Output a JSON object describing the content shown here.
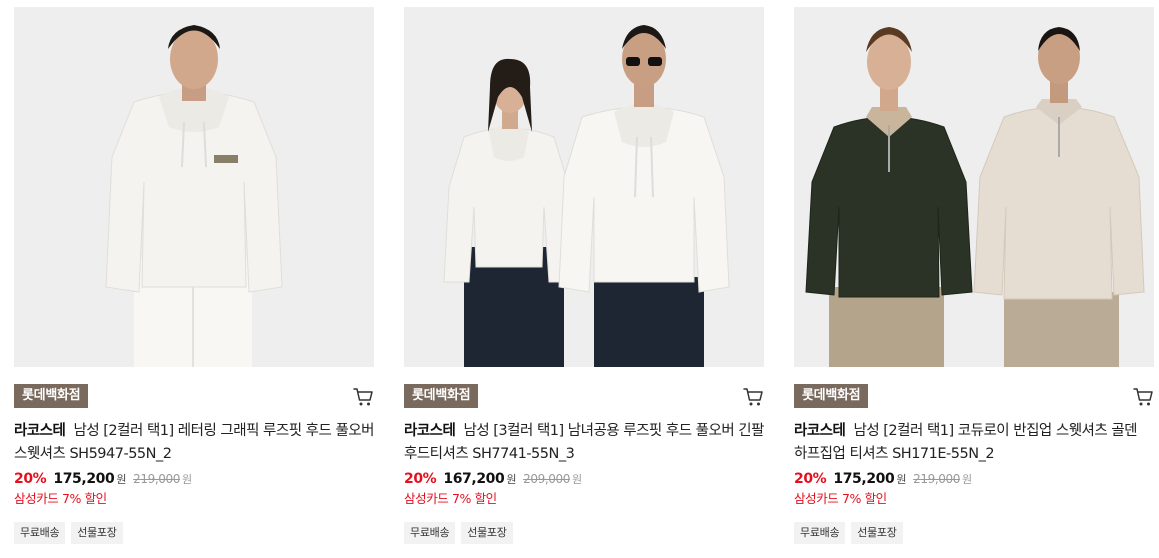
{
  "products": [
    {
      "store": "롯데백화점",
      "brand": "라코스테",
      "name": "남성 [2컬러 택1] 레터링 그래픽 루즈핏 후드 풀오버 스웻셔츠 SH5947-55N_2",
      "discount": "20%",
      "price": "175,200",
      "currency": "원",
      "original_price": "219,000",
      "card_promo": "삼성카드 7% 할인",
      "tags": [
        "무료배송",
        "선물포장"
      ],
      "image": {
        "description": "model in white hoodie and white pants",
        "top_color": "#f4f3ef",
        "bottom_color": "#f7f6f3",
        "bg_color": "#eeeeee"
      }
    },
    {
      "store": "롯데백화점",
      "brand": "라코스테",
      "name": "남성 [3컬러 택1] 남녀공용 루즈핏 후드 풀오버 긴팔 후드티셔츠 SH7741-55N_3",
      "discount": "20%",
      "price": "167,200",
      "currency": "원",
      "original_price": "209,000",
      "card_promo": "삼성카드 7% 할인",
      "tags": [
        "무료배송",
        "선물포장"
      ],
      "image": {
        "description": "two models in white hoodies and navy bottoms",
        "top_color": "#f4f3ef",
        "bottom_color": "#1e2533",
        "bg_color": "#eeeeee"
      }
    },
    {
      "store": "롯데백화점",
      "brand": "라코스테",
      "name": "남성 [2컬러 택1] 코듀로이 반집업 스웻셔츠 골덴 하프집업 티셔츠 SH171E-55N_2",
      "discount": "20%",
      "price": "175,200",
      "currency": "원",
      "original_price": "219,000",
      "card_promo": "삼성카드 7% 할인",
      "tags": [
        "무료배송",
        "선물포장"
      ],
      "image": {
        "description": "two models in dark green and beige half-zip sweatshirts",
        "top_color": "#2a3325",
        "top_color_2": "#e6ddd2",
        "bottom_color": "#b5a48c",
        "bg_color": "#eeeeee"
      }
    }
  ]
}
